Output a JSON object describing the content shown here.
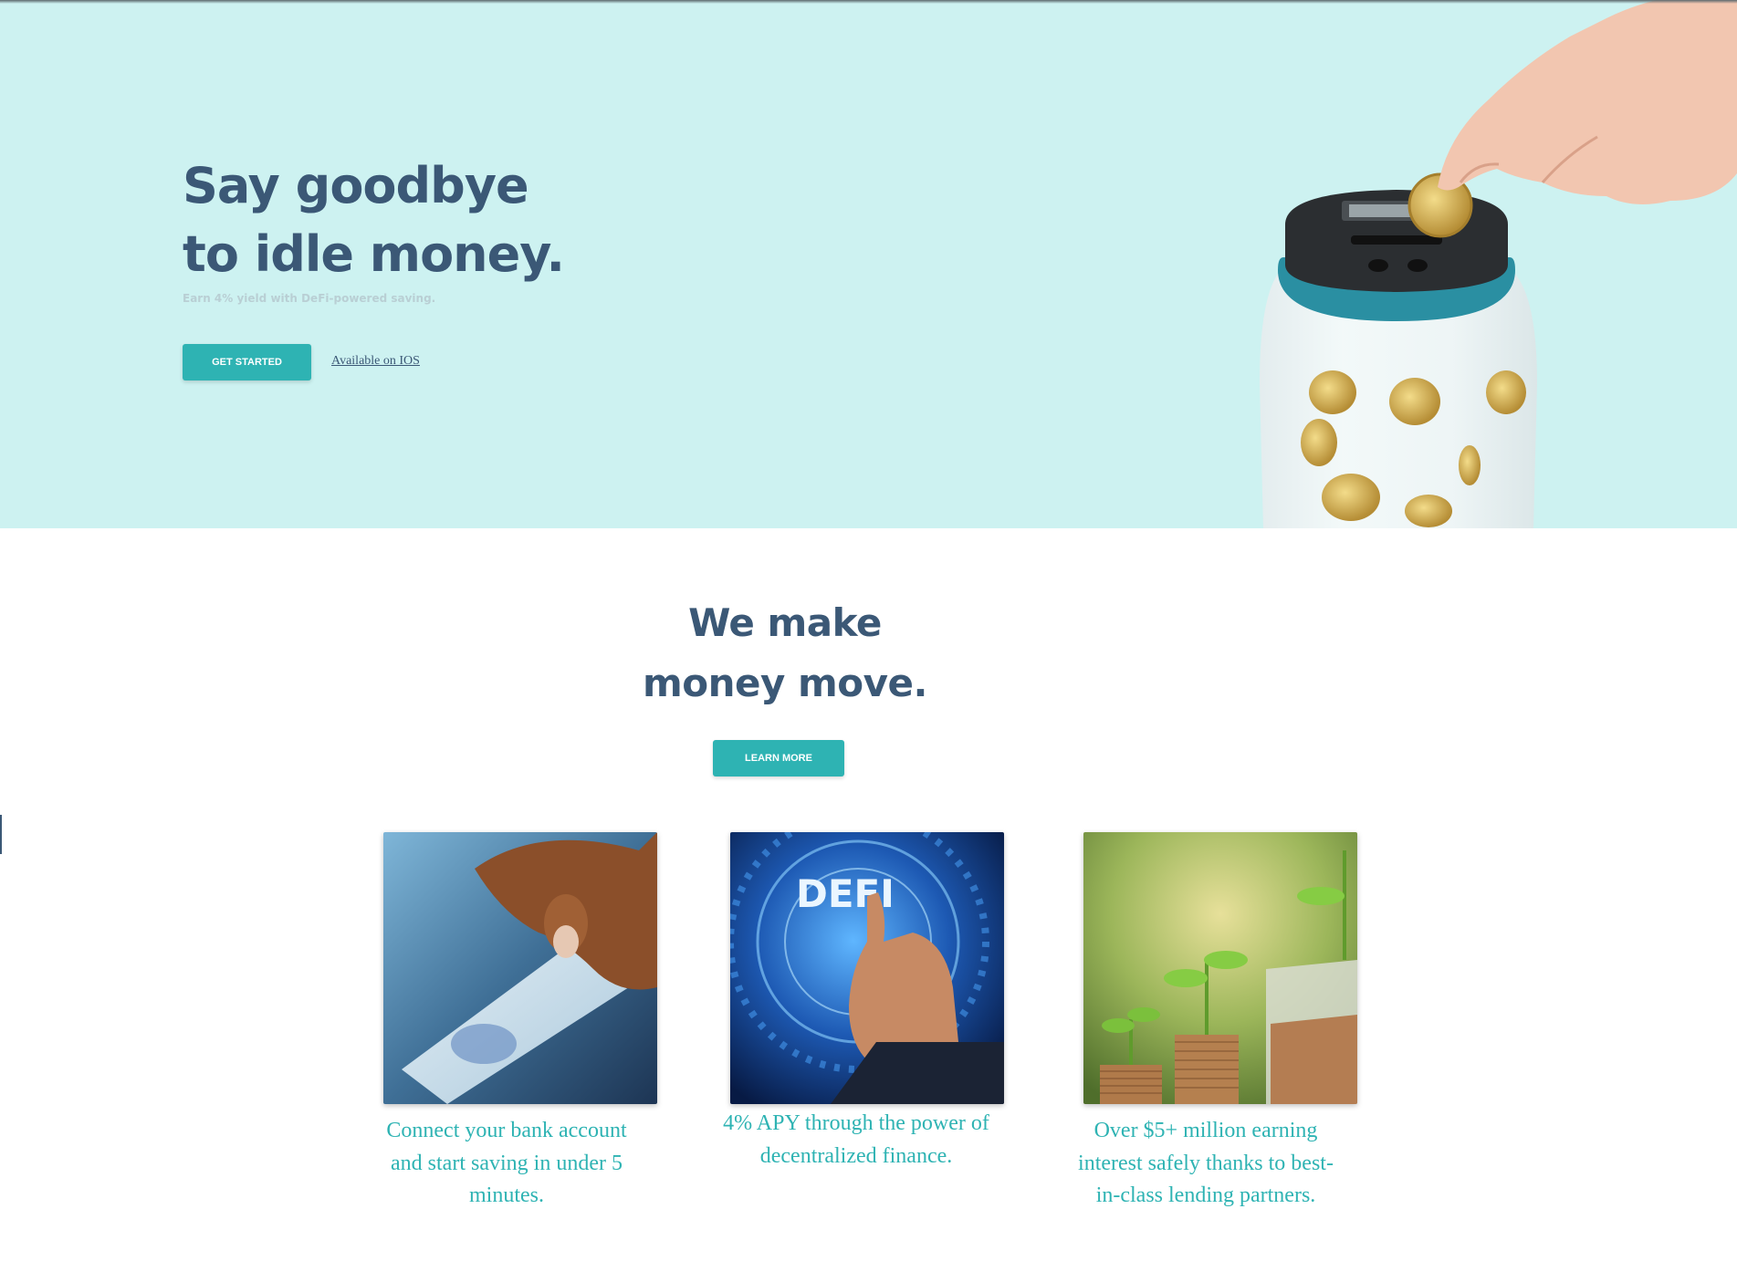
{
  "hero": {
    "title_line1": "Say goodbye",
    "title_line2": "to idle money.",
    "subtitle": "Earn 4% yield with DeFi-powered saving.",
    "cta_label": "GET STARTED",
    "ios_link": "Available on IOS",
    "background_color": "#cdf2f1",
    "image_icon": "coin-jar-illustration"
  },
  "section": {
    "title_line1": "We make",
    "title_line2": "money move.",
    "cta_label": "LEARN MORE"
  },
  "cards": [
    {
      "image_icon": "credit-card-photo",
      "caption": "Connect your bank account and start saving in under 5 minutes."
    },
    {
      "image_icon": "defi-photo",
      "image_text": "DEFI",
      "caption": "4% APY through the power of decentralized finance."
    },
    {
      "image_icon": "coins-plants-photo",
      "caption": "Over $5+ million earning interest safely thanks to best-in-class lending partners."
    }
  ],
  "colors": {
    "accent": "#2eb3b3",
    "heading": "#3b5876",
    "caption": "#2eb3b3"
  }
}
